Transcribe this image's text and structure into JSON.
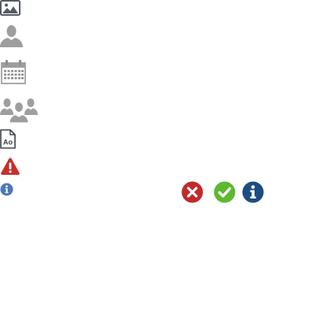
{
  "icons": {
    "image": "image-icon",
    "user": "user-icon",
    "calendar": "calendar-icon",
    "group": "group-icon",
    "font_file": "font-file-icon",
    "warning": "warning-icon",
    "info_small": "info-icon",
    "error": "error-circle-icon",
    "success": "success-check-icon",
    "info": "info-circle-icon"
  },
  "font_file": {
    "label": "Ao"
  },
  "colors": {
    "gray_icon": "#9e9e9e",
    "dark_gray": "#555b62",
    "warning_red": "#c7302a",
    "info_blue_small": "#4a77b9",
    "error_red": "#c02a2a",
    "success_green": "#5db832",
    "info_blue": "#1c4d82"
  }
}
